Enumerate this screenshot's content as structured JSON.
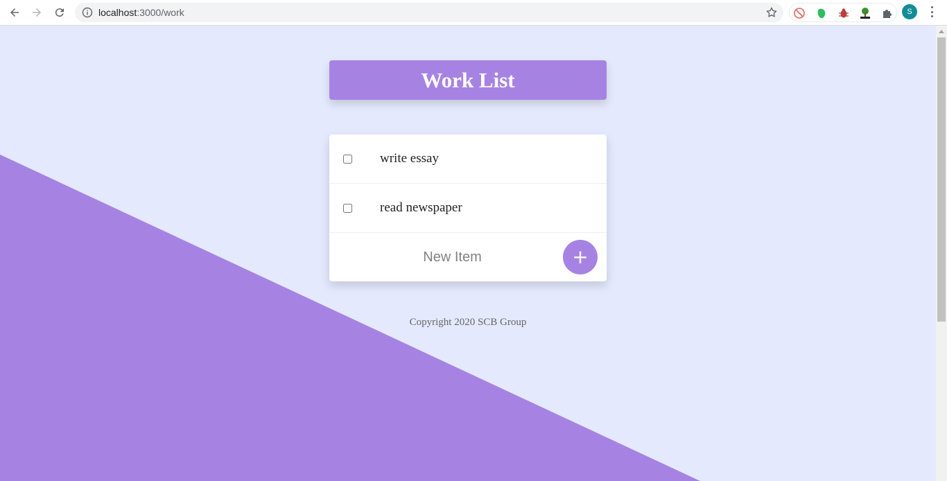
{
  "browser": {
    "url_host": "localhost",
    "url_path": ":3000/work",
    "profile_initial": "S",
    "extensions": [
      "blocked-icon",
      "evernote-icon",
      "bug-icon",
      "html-tree-icon",
      "puzzle-icon"
    ]
  },
  "page": {
    "title": "Work List",
    "items": [
      {
        "label": "write essay",
        "checked": false
      },
      {
        "label": "read newspaper",
        "checked": false
      }
    ],
    "new_item_placeholder": "New Item",
    "add_button_label": "+",
    "footer": "Copyright 2020 SCB Group"
  },
  "colors": {
    "accent": "#a683e3",
    "background": "#e4e9fd"
  }
}
